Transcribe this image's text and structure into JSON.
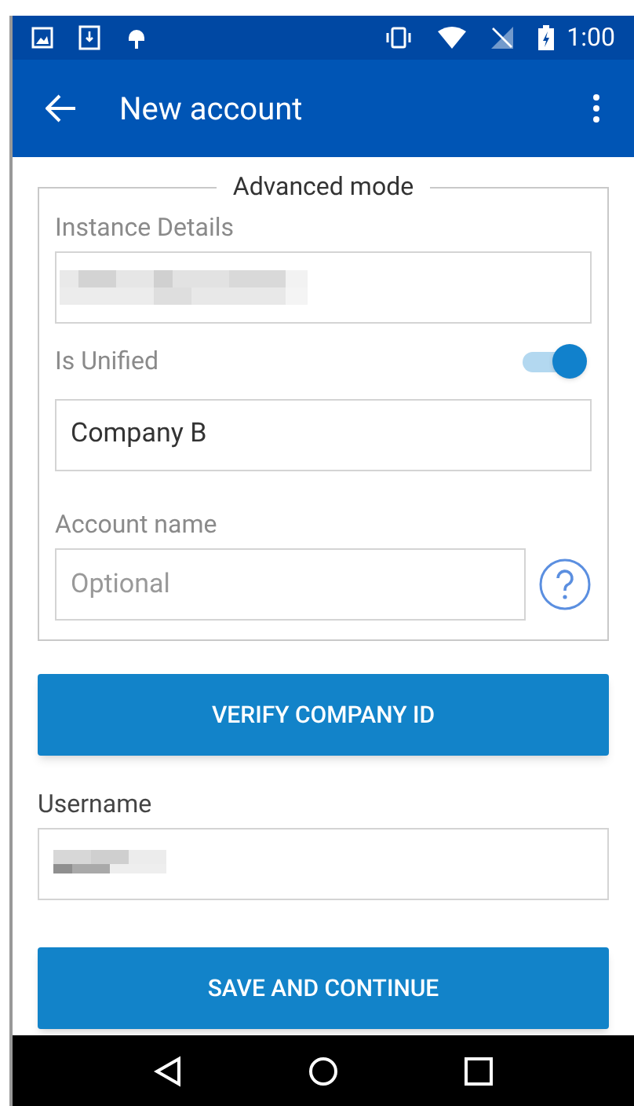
{
  "status_bar": {
    "time": "1:00"
  },
  "app_bar": {
    "title": "New account"
  },
  "advanced": {
    "legend": "Advanced mode",
    "items": [
      {
        "kind": "label",
        "text": "Instance Details"
      },
      {
        "kind": "redacted_field"
      },
      {
        "kind": "switch",
        "label": "Is Unified",
        "on": true
      },
      {
        "kind": "field",
        "value": "Company B"
      },
      {
        "kind": "label",
        "text": "Account name"
      },
      {
        "kind": "help_field",
        "placeholder": "Optional"
      }
    ]
  },
  "verify_button": "VERIFY COMPANY ID",
  "username": {
    "label": "Username"
  },
  "save_button": "SAVE AND CONTINUE"
}
